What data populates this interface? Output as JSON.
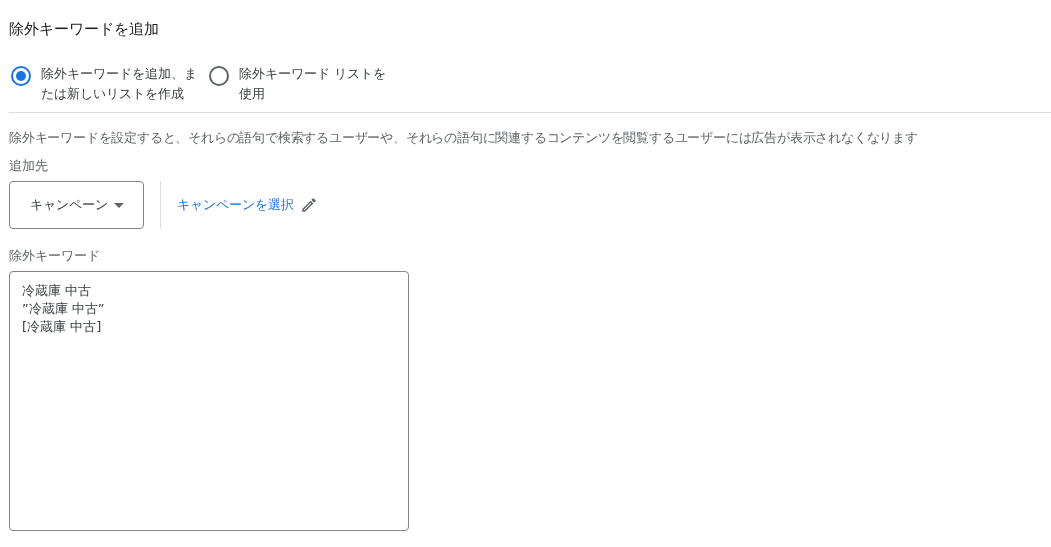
{
  "title": "除外キーワードを追加",
  "options": [
    {
      "label": "除外キーワードを追加、または新しいリストを作成",
      "selected": true
    },
    {
      "label": "除外キーワード リストを使用",
      "selected": false
    }
  ],
  "description": "除外キーワードを設定すると、それらの語句で検索するユーザーや、それらの語句に関連するコンテンツを閲覧するユーザーには広告が表示されなくなります",
  "target": {
    "label": "追加先",
    "dropdown": "キャンペーン",
    "link": "キャンペーンを選択"
  },
  "keywords": {
    "label": "除外キーワード",
    "value": "冷蔵庫 中古\n”冷蔵庫 中古”\n[冷蔵庫 中古]"
  }
}
